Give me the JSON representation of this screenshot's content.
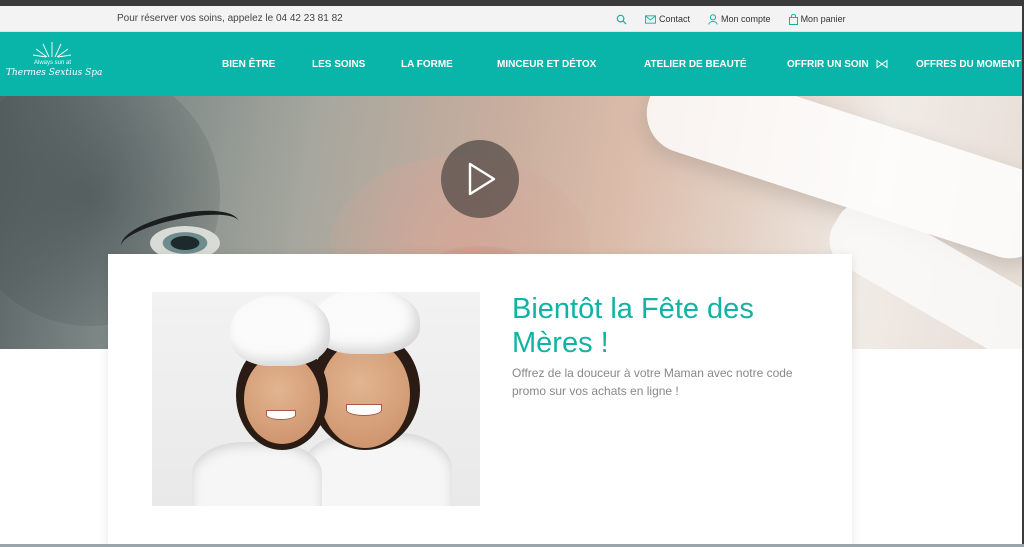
{
  "topbar": {
    "phone_text": "Pour réserver vos soins, appelez le 04 42 23 81 82",
    "links": [
      {
        "icon": "search-icon",
        "label": ""
      },
      {
        "icon": "mail-icon",
        "label": "Contact"
      },
      {
        "icon": "user-icon",
        "label": "Mon compte"
      },
      {
        "icon": "bag-icon",
        "label": "Mon panier"
      }
    ]
  },
  "logo": {
    "small_text": "Always sun at",
    "script_text": "Thermes Sextius Spa"
  },
  "nav": {
    "items": [
      "BIEN ÊTRE",
      "LES SOINS",
      "LA FORME",
      "MINCEUR ET DÉTOX",
      "ATELIER DE BEAUTÉ",
      "OFFRIR UN SOIN",
      "OFFRES DU MOMENT"
    ]
  },
  "hero": {
    "play_icon": "play-icon"
  },
  "promo": {
    "headline": "Bientôt la Fête des Mères !",
    "body": "Offrez de la douceur à votre Maman avec notre code promo sur vos achats en ligne !"
  },
  "colors": {
    "brand": "#08b5a8",
    "headline": "#12b3a4",
    "utility_bg": "#f3f3f3"
  }
}
